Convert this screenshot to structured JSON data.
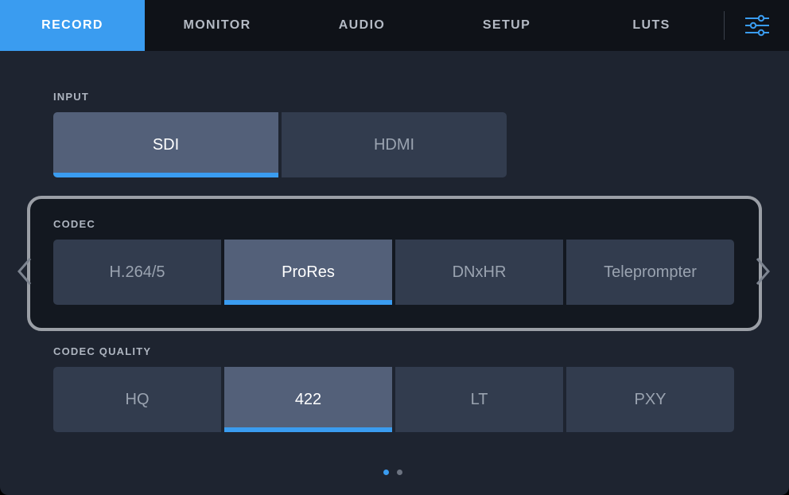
{
  "tabs": [
    {
      "label": "RECORD",
      "active": true
    },
    {
      "label": "MONITOR",
      "active": false
    },
    {
      "label": "AUDIO",
      "active": false
    },
    {
      "label": "SETUP",
      "active": false
    },
    {
      "label": "LUTS",
      "active": false
    }
  ],
  "settings_icon": "sliders-icon",
  "input": {
    "label": "INPUT",
    "options": [
      "SDI",
      "HDMI"
    ],
    "selected": "SDI"
  },
  "codec": {
    "label": "CODEC",
    "options": [
      "H.264/5",
      "ProRes",
      "DNxHR",
      "Teleprompter"
    ],
    "selected": "ProRes"
  },
  "codec_quality": {
    "label": "CODEC QUALITY",
    "options": [
      "HQ",
      "422",
      "LT",
      "PXY"
    ],
    "selected": "422"
  },
  "pager": {
    "pages": 2,
    "current": 1
  },
  "colors": {
    "accent": "#3a9cf0",
    "tab_bar": "#0f1218",
    "background": "#1e2430",
    "segment": "#323c4e",
    "segment_selected": "#536079"
  }
}
